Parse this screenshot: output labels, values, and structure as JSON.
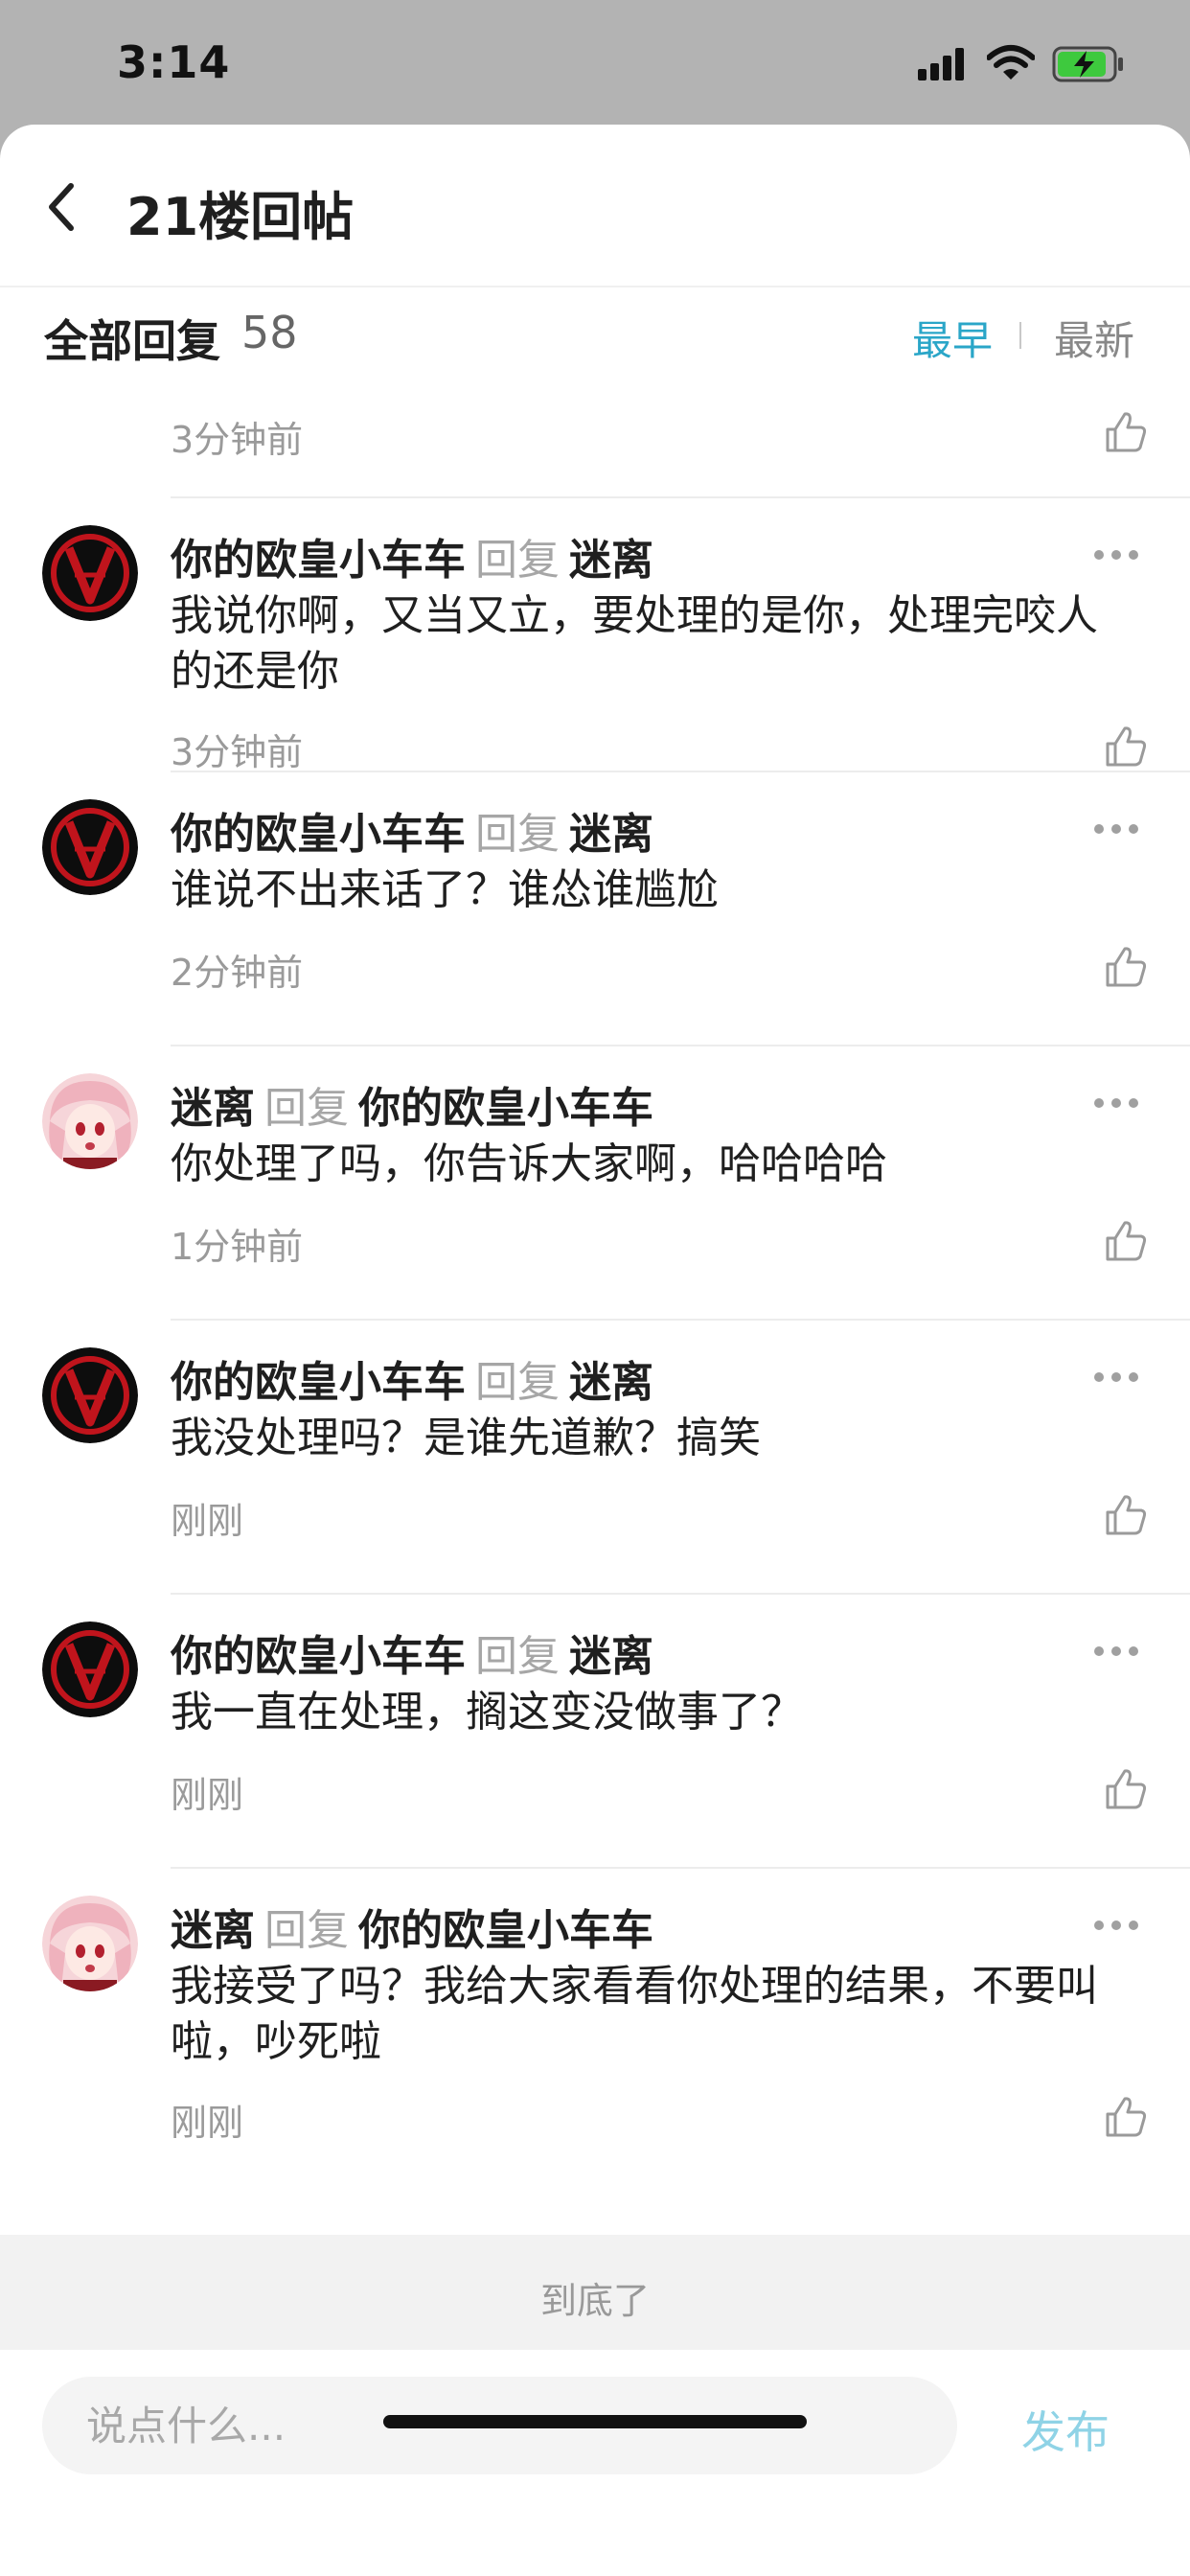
{
  "status_bar": {
    "time": "3:14"
  },
  "header": {
    "back_icon": "chevron-left-icon",
    "title": "21楼回帖"
  },
  "reply_header": {
    "title": "全部回复",
    "count": "58",
    "sort_earliest": "最早",
    "sort_newest": "最新",
    "active_color": "#2aa6c8"
  },
  "previous_comment": {
    "time": "3分钟前"
  },
  "comments": [
    {
      "avatar": "v-logo-avatar",
      "user": "你的欧皇小车车",
      "reply_word": "回复",
      "reply_to": "迷离",
      "content": "我说你啊，又当又立，要处理的是你，处理完咬人的还是你",
      "time": "3分钟前"
    },
    {
      "avatar": "v-logo-avatar",
      "user": "你的欧皇小车车",
      "reply_word": "回复",
      "reply_to": "迷离",
      "content": "谁说不出来话了？谁怂谁尴尬",
      "time": "2分钟前"
    },
    {
      "avatar": "anime-girl-avatar",
      "user": "迷离",
      "reply_word": "回复",
      "reply_to": "你的欧皇小车车",
      "content": "你处理了吗，你告诉大家啊，哈哈哈哈",
      "time": "1分钟前"
    },
    {
      "avatar": "v-logo-avatar",
      "user": "你的欧皇小车车",
      "reply_word": "回复",
      "reply_to": "迷离",
      "content": "我没处理吗？是谁先道歉？搞笑",
      "time": "刚刚"
    },
    {
      "avatar": "v-logo-avatar",
      "user": "你的欧皇小车车",
      "reply_word": "回复",
      "reply_to": "迷离",
      "content": "我一直在处理，搁这变没做事了？",
      "time": "刚刚"
    },
    {
      "avatar": "anime-girl-avatar",
      "user": "迷离",
      "reply_word": "回复",
      "reply_to": "你的欧皇小车车",
      "content": "我接受了吗？我给大家看看你处理的结果，不要叫啦，吵死啦",
      "time": "刚刚"
    }
  ],
  "end_text": "到底了",
  "input": {
    "placeholder": "说点什么..."
  },
  "publish_label": "发布",
  "publish_color": "#8fd3e6"
}
